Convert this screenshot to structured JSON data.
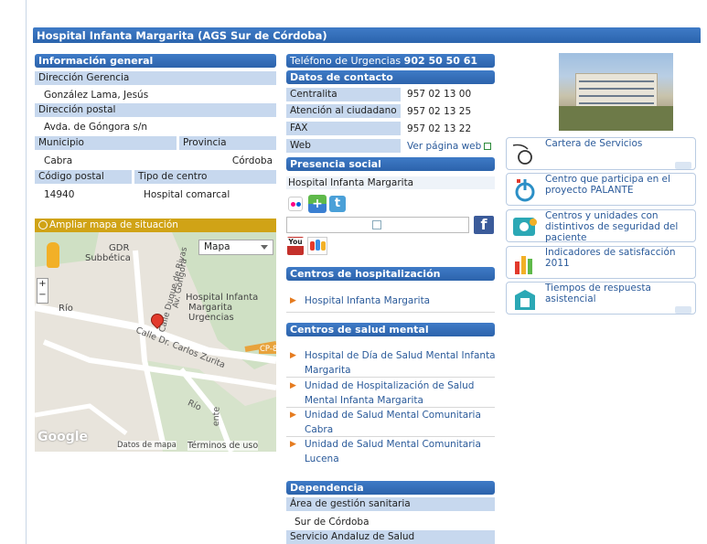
{
  "page": {
    "title": "Hospital Infanta Margarita (AGS Sur de Córdoba)"
  },
  "info": {
    "header": "Información general",
    "gerencia_label": "Dirección Gerencia",
    "gerencia_value": "González Lama, Jesús",
    "postal_label": "Dirección postal",
    "postal_value": "Avda. de Góngora s/n",
    "municipio_label": "Municipio",
    "municipio_value": "Cabra",
    "provincia_label": "Provincia",
    "provincia_value": "Córdoba",
    "cp_label": "Código postal",
    "cp_value": "14940",
    "tipo_label": "Tipo de centro",
    "tipo_value": "Hospital comarcal"
  },
  "map": {
    "bar_label": "Ampliar mapa de situación",
    "type_select": "Mapa",
    "labels": {
      "gdr": "GDR",
      "subbetica": "Subbética",
      "hospital": "Hospital Infanta",
      "margarita": "Margarita",
      "urgencias": "Urgencias",
      "calle_duque": "Calle Duque de Rivas",
      "av_gongora": "Av. Góngora",
      "calle_dr": "Calle Dr. Carlos Zurita",
      "rio": "Río",
      "rio2": "Río",
      "cp": "CP-8",
      "ente": "ente"
    },
    "footer_logo": "Google",
    "footer_data": "Datos de mapa",
    "footer_terms": "Términos de uso"
  },
  "contact": {
    "urgencias_label": "Teléfono de Urgencias",
    "urgencias_value": "902 50 50 61",
    "header": "Datos de contacto",
    "rows": [
      {
        "label": "Centralita",
        "value": "957 02 13 00"
      },
      {
        "label": "Atención al ciudadano",
        "value": "957 02 13 25"
      },
      {
        "label": "FAX",
        "value": "957 02 13 22"
      },
      {
        "label": "Web",
        "value": "Ver página web"
      }
    ]
  },
  "social": {
    "header": "Presencia social",
    "name": "Hospital Infanta Margarita",
    "fb": "f",
    "yt": "You"
  },
  "hosp": {
    "header": "Centros de hospitalización",
    "items": [
      "Hospital Infanta Margarita"
    ]
  },
  "mental": {
    "header": "Centros de salud mental",
    "items": [
      "Hospital de Día de Salud Mental Infanta Margarita",
      "Unidad de Hospitalización de Salud Mental Infanta Margarita",
      "Unidad de Salud Mental Comunitaria Cabra",
      "Unidad de Salud Mental Comunitaria Lucena"
    ]
  },
  "dep": {
    "header": "Dependencia",
    "area_label": "Área de gestión sanitaria",
    "area_value": "Sur de Córdoba",
    "sas_label": "Servicio Andaluz de Salud"
  },
  "services": [
    {
      "label": "Cartera de Servicios",
      "icon": "stethoscope-icon"
    },
    {
      "label": "Centro que participa en el proyecto PALANTE",
      "icon": "power-icon"
    },
    {
      "label": "Centros y unidades con distintivos de seguridad del paciente",
      "icon": "safety-icon"
    },
    {
      "label": "Indicadores de satisfacción 2011",
      "icon": "bar-chart-icon"
    },
    {
      "label": "Tiempos de respuesta asistencial",
      "icon": "hospital-clock-icon"
    }
  ],
  "colors": {
    "accent": "#2c63ab",
    "label_bg": "#c7d8ee",
    "map_bar": "#d0a316",
    "link": "#2a5a9a",
    "bullet": "#e57b1f"
  }
}
